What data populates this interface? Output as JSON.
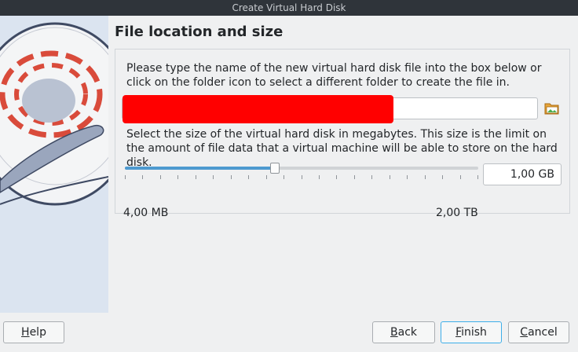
{
  "window": {
    "title": "Create Virtual Hard Disk"
  },
  "page": {
    "heading": "File location and size"
  },
  "location": {
    "instructions": "Please type the name of the new virtual hard disk file into the box below or click on the folder icon to select a different folder to create the file in.",
    "file_name_value": "",
    "folder_icon": "folder-open-icon"
  },
  "size": {
    "instructions": "Select the size of the virtual hard disk in megabytes. This size is the limit on the amount of file data that a virtual machine will be able to store on the hard disk.",
    "value": "1,00 GB",
    "min_label": "4,00 MB",
    "max_label": "2,00 TB",
    "slider_fraction": 0.425
  },
  "buttons": {
    "help": {
      "mnemonic": "H",
      "rest": "elp"
    },
    "back": {
      "mnemonic": "B",
      "rest": "ack"
    },
    "finish": {
      "mnemonic": "F",
      "rest": "inish"
    },
    "cancel": {
      "mnemonic": "C",
      "rest": "ancel"
    }
  },
  "colors": {
    "accent": "#3daee9",
    "slider_fill": "#4d9ad0",
    "redaction": "#ff0000"
  }
}
